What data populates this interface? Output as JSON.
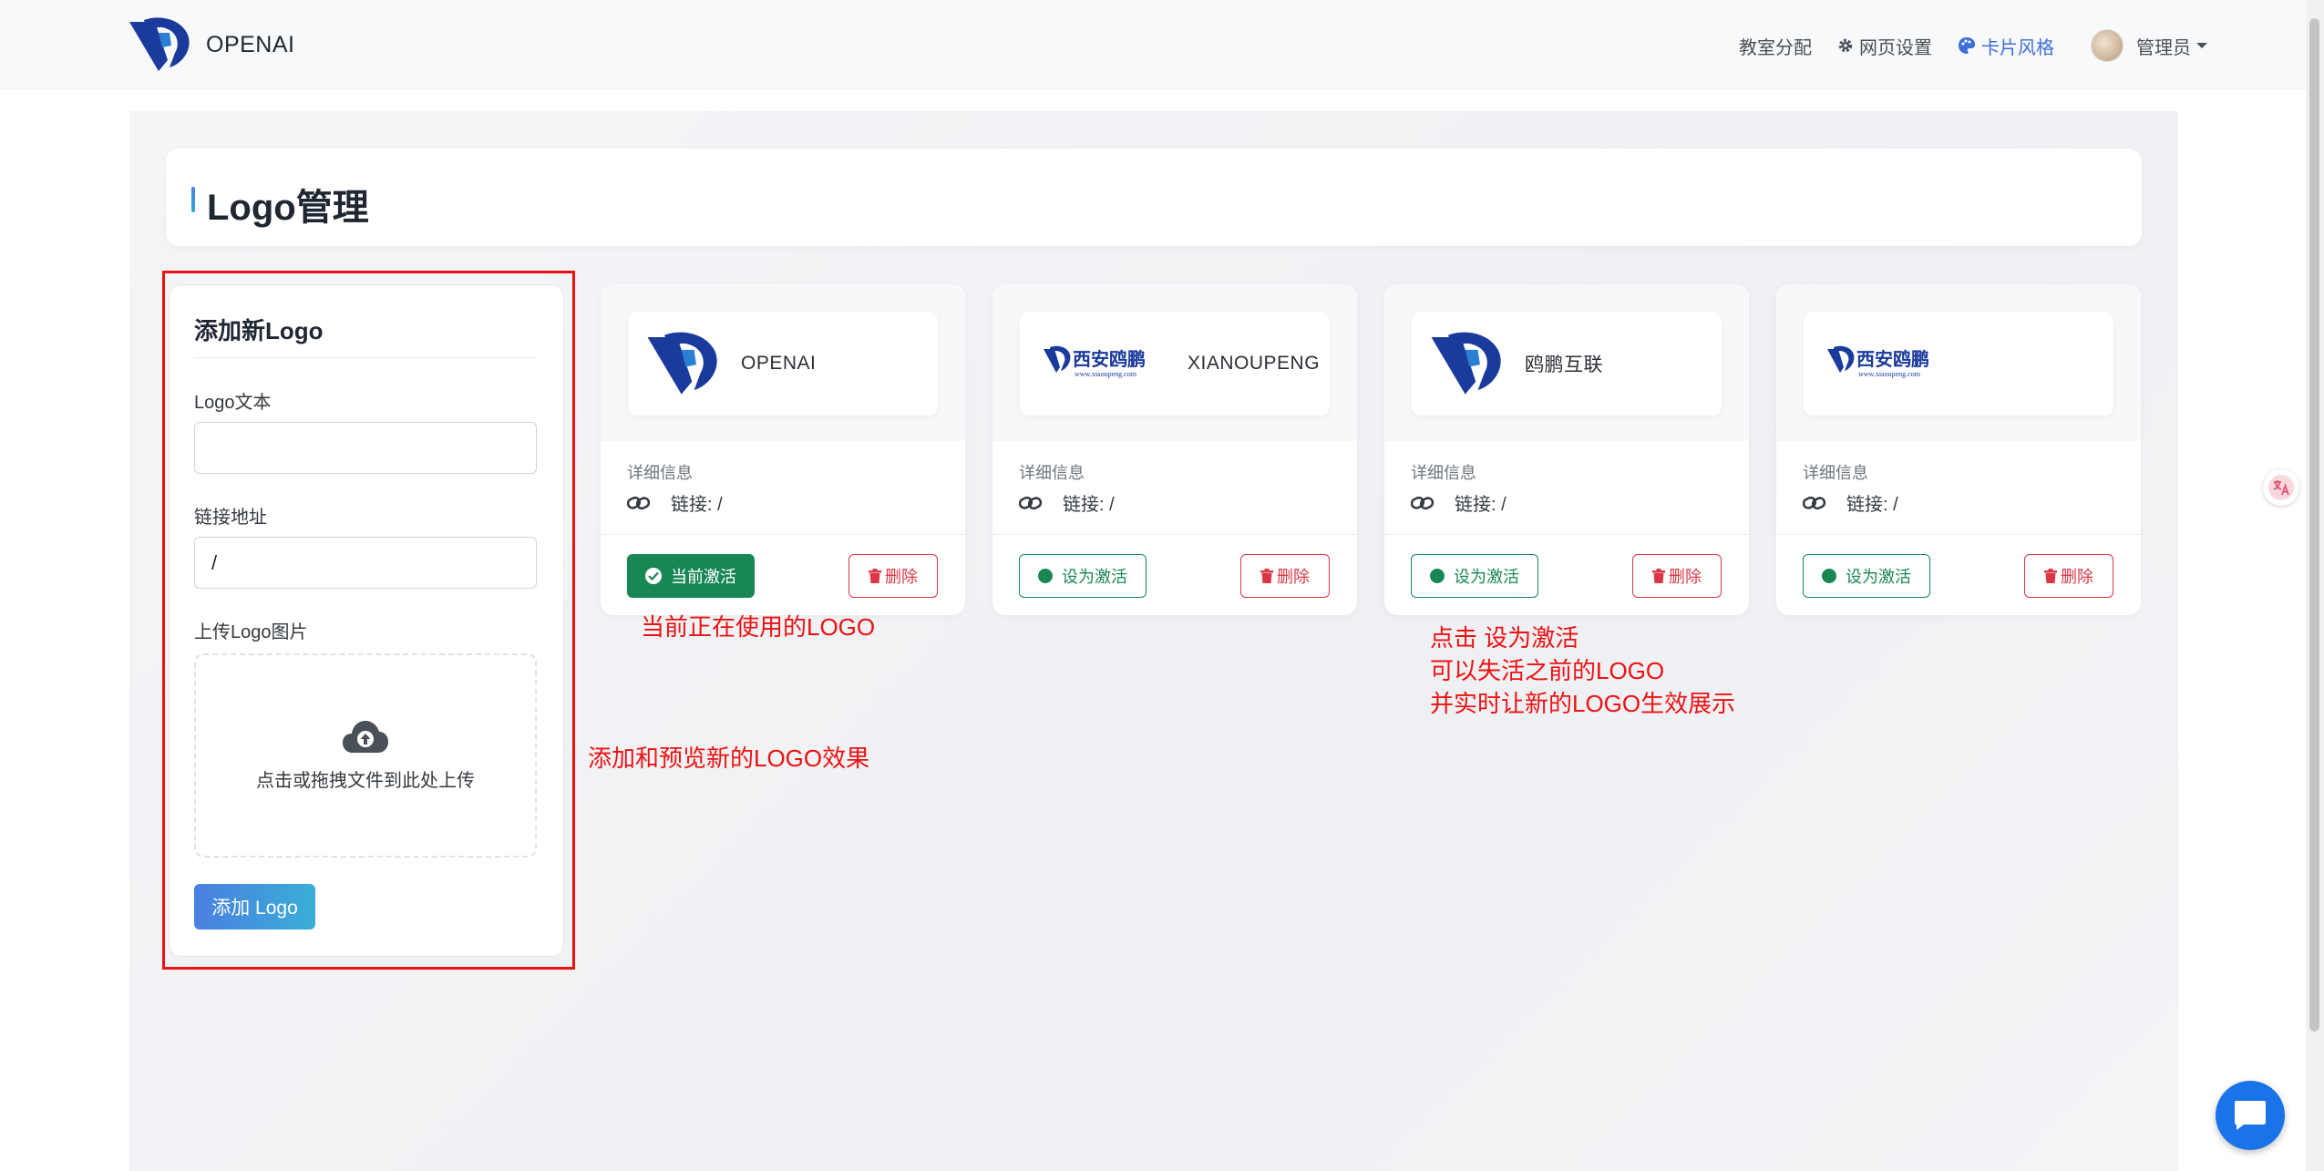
{
  "navbar": {
    "brand_text": "OPENAI",
    "links": {
      "classroom": "教室分配",
      "settings": "网页设置",
      "card_style": "卡片风格",
      "user": "管理员"
    }
  },
  "page": {
    "title": "Logo管理"
  },
  "add_form": {
    "title": "添加新Logo",
    "text_label": "Logo文本",
    "text_value": "",
    "link_label": "链接地址",
    "link_value": "/",
    "upload_label": "上传Logo图片",
    "upload_hint": "点击或拖拽文件到此处上传",
    "submit_label": "添加 Logo"
  },
  "logos": [
    {
      "preview_text": "OPENAI",
      "detail_label": "详细信息",
      "link_text": "链接: /",
      "status_label": "当前激活",
      "delete_label": "删除",
      "active": true
    },
    {
      "preview_text": "XIANOUPENG",
      "detail_label": "详细信息",
      "link_text": "链接: /",
      "status_label": "设为激活",
      "delete_label": "删除",
      "active": false
    },
    {
      "preview_text": "鸥鹏互联",
      "detail_label": "详细信息",
      "link_text": "链接: /",
      "status_label": "设为激活",
      "delete_label": "删除",
      "active": false
    },
    {
      "preview_text": "",
      "detail_label": "详细信息",
      "link_text": "链接: /",
      "status_label": "设为激活",
      "delete_label": "删除",
      "active": false
    }
  ],
  "logo_image_text": {
    "name": "西安鸥鹏",
    "url": "www.xiaoupeng.com"
  },
  "annotations": {
    "current": "当前正在使用的LOGO",
    "add_preview": "添加和预览新的LOGO效果",
    "activate_line1": "点击 设为激活",
    "activate_line2": "可以失活之前的LOGO",
    "activate_line3": "并实时让新的LOGO生效展示"
  },
  "colors": {
    "accent": "#3d6fd6",
    "success": "#198754",
    "danger": "#dc3545",
    "annotation": "#ee1111",
    "brand": "#1a3a9c"
  }
}
